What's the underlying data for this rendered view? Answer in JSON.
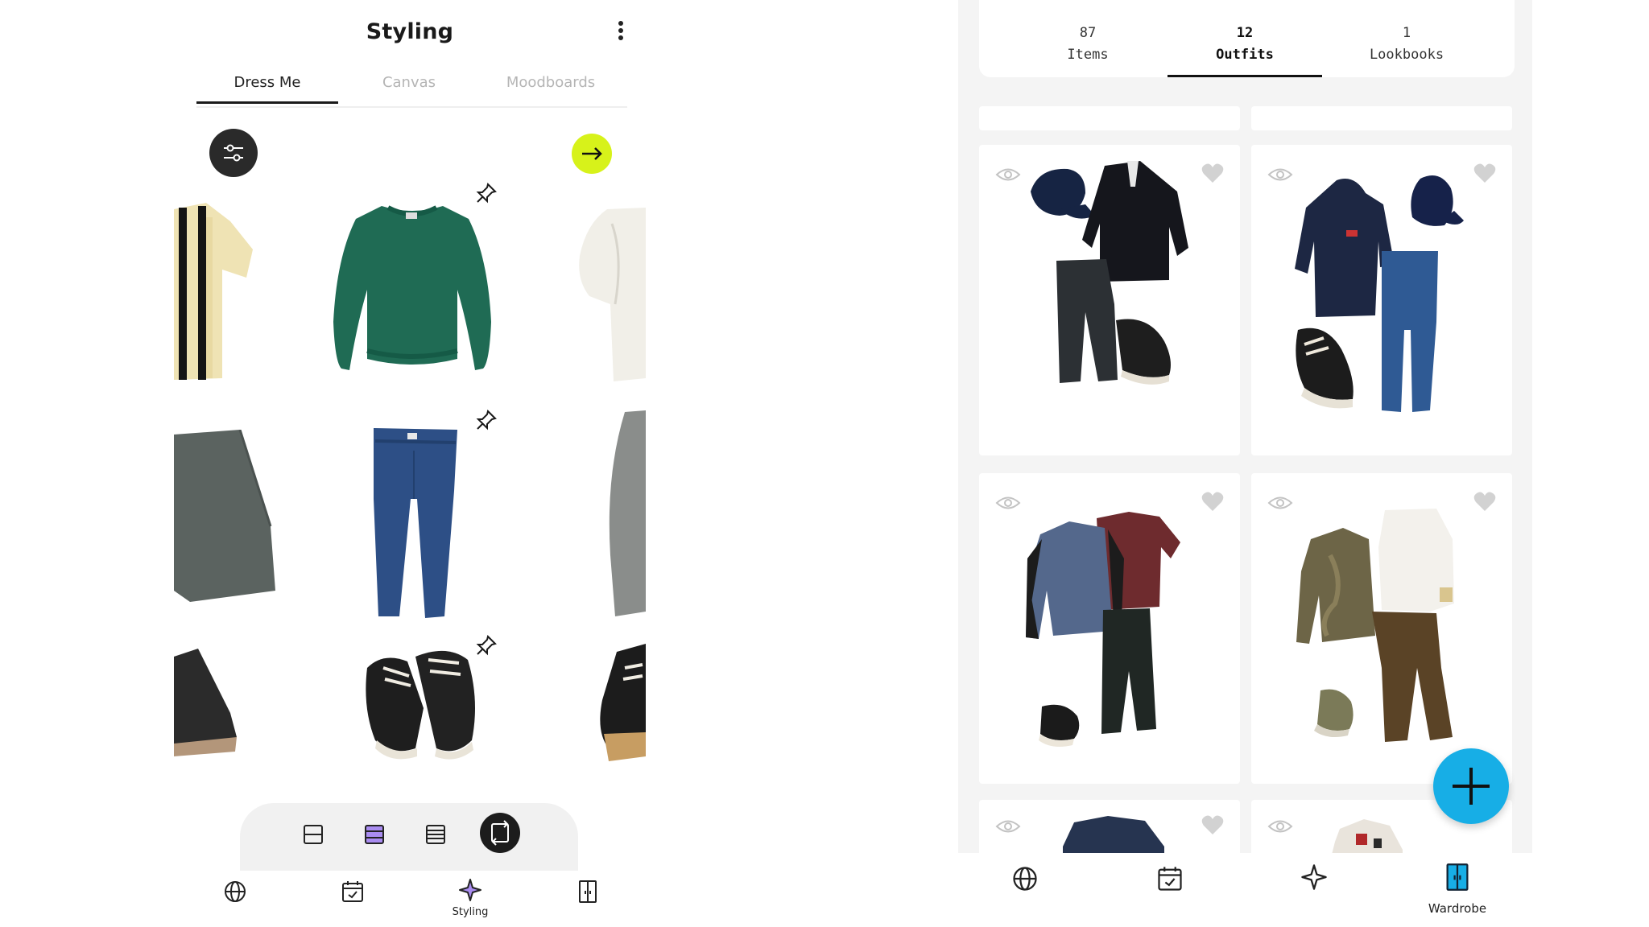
{
  "left": {
    "title": "Styling",
    "tabs": [
      {
        "label": "Dress Me",
        "active": true
      },
      {
        "label": "Canvas",
        "active": false
      },
      {
        "label": "Moodboards",
        "active": false
      }
    ],
    "filter_icon": "sliders-icon",
    "next_icon": "arrow-right-icon",
    "accent_color": "#d7f21a",
    "rows": [
      {
        "name": "tops",
        "center": "green sweatshirt",
        "pinned": true
      },
      {
        "name": "bottoms",
        "center": "blue jeans",
        "pinned": true
      },
      {
        "name": "shoes",
        "center": "black sneakers",
        "pinned": true
      }
    ],
    "view_modes": [
      "one-row-icon",
      "two-row-icon",
      "three-row-icon",
      "shuffle-icon"
    ],
    "active_view_color": "#a98cf0",
    "nav": [
      {
        "icon": "globe-icon",
        "label": ""
      },
      {
        "icon": "calendar-check-icon",
        "label": ""
      },
      {
        "icon": "sparkle-icon",
        "label": "Styling",
        "active": true
      },
      {
        "icon": "wardrobe-icon",
        "label": ""
      }
    ]
  },
  "right": {
    "stats": [
      {
        "count": "87",
        "label": "Items",
        "active": false
      },
      {
        "count": "12",
        "label": "Outfits",
        "active": true
      },
      {
        "count": "1",
        "label": "Lookbooks",
        "active": false
      }
    ],
    "outfits": [
      {
        "name": "outfit-navy-cap-black-rugby"
      },
      {
        "name": "outfit-navy-hoodie-jeans"
      },
      {
        "name": "outfit-denim-jacket-maroon-tee"
      },
      {
        "name": "outfit-olive-jacket-cargo"
      },
      {
        "name": "outfit-navy-shirt"
      },
      {
        "name": "outfit-printed-shirt"
      }
    ],
    "fab_icon": "plus-icon",
    "fab_color": "#17aee6",
    "nav": [
      {
        "icon": "globe-icon",
        "label": ""
      },
      {
        "icon": "calendar-check-icon",
        "label": ""
      },
      {
        "icon": "sparkle-icon",
        "label": ""
      },
      {
        "icon": "wardrobe-icon",
        "label": "Wardrobe",
        "active": true
      }
    ],
    "wardrobe_color": "#17aee6"
  }
}
